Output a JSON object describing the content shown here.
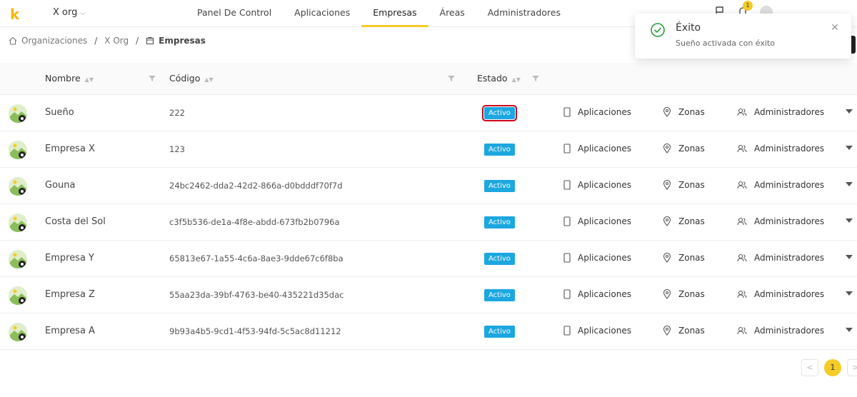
{
  "header": {
    "logo": "k",
    "org": "X org",
    "tabs": [
      {
        "label": "Panel De Control"
      },
      {
        "label": "Aplicaciones"
      },
      {
        "label": "Empresas"
      },
      {
        "label": "Áreas"
      },
      {
        "label": "Administradores"
      }
    ],
    "active_tab": "Empresas",
    "notification_count": "1"
  },
  "breadcrumb": {
    "items": [
      "Organizaciones",
      "X Org",
      "Empresas"
    ]
  },
  "table": {
    "columns": {
      "name": "Nombre",
      "code": "Código",
      "status": "Estado"
    },
    "rows": [
      {
        "name": "Sueño",
        "code": "222",
        "status": "Activo"
      },
      {
        "name": "Empresa X",
        "code": "123",
        "status": "Activo"
      },
      {
        "name": "Gouna",
        "code": "24bc2462-dda2-42d2-866a-d0bdddf70f7d",
        "status": "Activo"
      },
      {
        "name": "Costa del Sol",
        "code": "c3f5b536-de1a-4f8e-abdd-673fb2b0796a",
        "status": "Activo"
      },
      {
        "name": "Empresa Y",
        "code": "65813e67-1a55-4c6a-8ae3-9dde67c6f8ba",
        "status": "Activo"
      },
      {
        "name": "Empresa Z",
        "code": "55aa23da-39bf-4763-be40-435221d35dac",
        "status": "Activo"
      },
      {
        "name": "Empresa A",
        "code": "9b93a4b5-9cd1-4f53-94fd-5c5ac8d11212",
        "status": "Activo"
      }
    ],
    "links": {
      "apps": "Aplicaciones",
      "zones": "Zonas",
      "admins": "Administradores"
    }
  },
  "toast": {
    "title": "Éxito",
    "message": "Sueño activada con éxito"
  },
  "pagination": {
    "current": "1",
    "prev": "<",
    "next": ">"
  },
  "colors": {
    "accent": "#f5cb28",
    "status": "#1ba7e0",
    "success": "#2a9d3c"
  }
}
